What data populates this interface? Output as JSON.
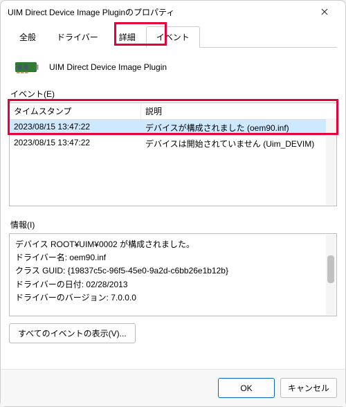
{
  "window": {
    "title": "UIM Direct Device Image Pluginのプロパティ"
  },
  "tabs": {
    "general": "全般",
    "driver": "ドライバー",
    "details": "詳細",
    "events": "イベント"
  },
  "device": {
    "name": "UIM Direct Device Image Plugin"
  },
  "eventsSection": {
    "label": "イベント(E)",
    "columns": {
      "timestamp": "タイムスタンプ",
      "description": "説明"
    },
    "rows": [
      {
        "timestamp": "2023/08/15 13:47:22",
        "description": "デバイスが構成されました (oem90.inf)"
      },
      {
        "timestamp": "2023/08/15 13:47:22",
        "description": "デバイスは開始されていません (Uim_DEVIM)"
      }
    ]
  },
  "infoSection": {
    "label": "情報(I)",
    "line1": "デバイス ROOT¥UIM¥0002 が構成されました。",
    "line2": "",
    "line3": "ドライバー名: oem90.inf",
    "line4": "クラス GUID: {19837c5c-96f5-45e0-9a2d-c6bb26e1b12b}",
    "line5": "ドライバーの日付: 02/28/2013",
    "line6": "ドライバーのバージョン: 7.0.0.0"
  },
  "buttons": {
    "viewAll": "すべてのイベントの表示(V)...",
    "ok": "OK",
    "cancel": "キャンセル"
  }
}
